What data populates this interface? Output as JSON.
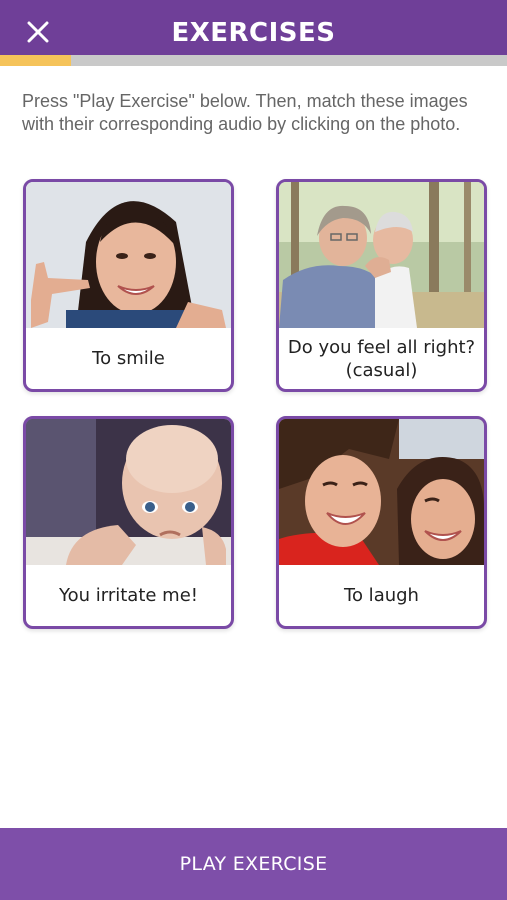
{
  "header": {
    "title": "EXERCISES",
    "close_icon": "close-icon"
  },
  "progress": {
    "fraction": 0.14
  },
  "instructions": "Press \"Play Exercise\" below. Then, match these images with their corresponding audio by clicking on the photo.",
  "cards": [
    {
      "caption": "To smile",
      "photo": "woman-smiling-photo"
    },
    {
      "caption": "Do you feel all right? (casual)",
      "photo": "elderly-couple-photo"
    },
    {
      "caption": "You irritate me!",
      "photo": "grumpy-baby-photo"
    },
    {
      "caption": "To laugh",
      "photo": "laughing-women-photo"
    }
  ],
  "footer": {
    "button_label": "PLAY EXERCISE"
  },
  "colors": {
    "header": "#6f3f98",
    "accent": "#7a4aa6",
    "progress": "#f5c35a",
    "button": "#7e4fa9"
  }
}
